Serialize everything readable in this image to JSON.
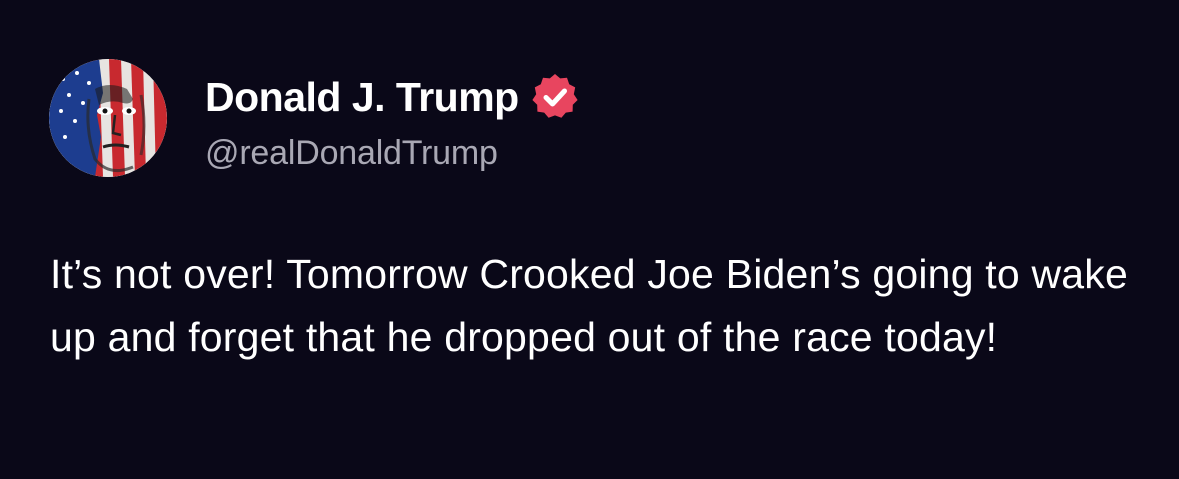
{
  "author": {
    "display_name": "Donald J. Trump",
    "handle": "@realDonaldTrump",
    "verified": true,
    "verified_badge_color": "#e8455f",
    "avatar_icon": "flag-painted-face-avatar"
  },
  "post": {
    "text": "It’s not over! Tomorrow Crooked Joe Biden’s going to wake up and forget that he dropped out of the race today!"
  },
  "colors": {
    "background": "#0a0818",
    "text": "#ffffff",
    "handle": "#a9a8b4"
  }
}
